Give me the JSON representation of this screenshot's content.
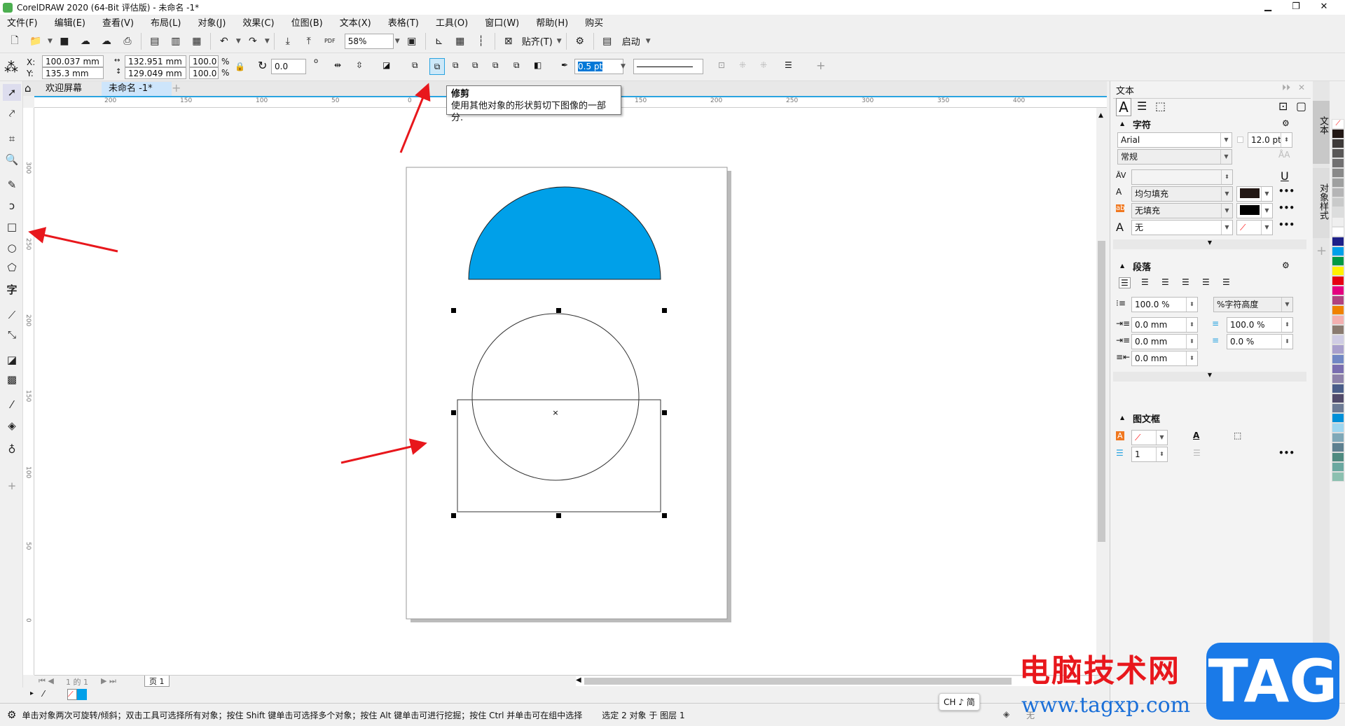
{
  "app": {
    "title": "CorelDRAW 2020 (64-Bit 评估版) - 未命名 -1*"
  },
  "menu": [
    "文件(F)",
    "编辑(E)",
    "查看(V)",
    "布局(L)",
    "对象(J)",
    "效果(C)",
    "位图(B)",
    "文本(X)",
    "表格(T)",
    "工具(O)",
    "窗口(W)",
    "帮助(H)",
    "购买"
  ],
  "toolbar": {
    "zoom": "58%",
    "snap_label": "贴齐(T)",
    "launch_label": "启动",
    "pdf_label": "PDF"
  },
  "props": {
    "x": "100.037 mm",
    "y": "135.3 mm",
    "x_label": "X:",
    "y_label": "Y:",
    "width": "132.951 mm",
    "height": "129.049 mm",
    "scale_x": "100.0",
    "scale_y": "100.0",
    "pct": "%",
    "rotation": "0.0",
    "outline": "0.5 pt",
    "deg": "o"
  },
  "tabs": {
    "welcome": "欢迎屏幕",
    "doc": "未命名 -1*"
  },
  "tooltip": {
    "title": "修剪",
    "body": "使用其他对象的形状剪切下图像的一部分."
  },
  "ruler": {
    "top": [
      "200",
      "150",
      "100",
      "50",
      "0",
      "150",
      "200",
      "250",
      "300",
      "350",
      "400"
    ],
    "left": [
      "300",
      "250",
      "200",
      "150",
      "100",
      "50",
      "0"
    ]
  },
  "docker": {
    "title": "文本",
    "character": {
      "heading": "字符",
      "font": "Arial",
      "size": "12.0 pt",
      "style": "常规",
      "fill": "均匀填充",
      "bg_fill": "无填充",
      "outline": "无"
    },
    "paragraph": {
      "heading": "段落",
      "line_spacing": "100.0 %",
      "spacing_unit": "%字符高度",
      "indent_first": "0.0 mm",
      "indent_left": "0.0 mm",
      "indent_right": "0.0 mm",
      "before": "100.0 %",
      "after": "0.0 %"
    },
    "frame": {
      "heading": "图文框",
      "columns": "1"
    },
    "side_tabs": [
      "文本",
      "对象样式"
    ],
    "more": "•••"
  },
  "palette": [
    "#231815",
    "#3e3a39",
    "#595757",
    "#717071",
    "#898989",
    "#9fa0a0",
    "#b5b5b6",
    "#c9caca",
    "#dcdddd",
    "#efefef",
    "#ffffff",
    "#1d2088",
    "#00a0e9",
    "#009944",
    "#fff100",
    "#e60012",
    "#e4007f",
    "#b0427f",
    "#ef8200",
    "#f3b0b0",
    "#8a7b70",
    "#cfcce4",
    "#a89fcc",
    "#7187c4",
    "#7a6eb0",
    "#8e82aa",
    "#4a5e8a",
    "#524b6b",
    "#6c7b95",
    "#0090d8",
    "#9dd6f0",
    "#7fa8b8",
    "#5e8090",
    "#4f8a80",
    "#6aa8a0",
    "#8cc0b0"
  ],
  "colors": {
    "shape_fill": "#00a0e9",
    "accent": "#29a3e0",
    "arrow": "#e8171c"
  },
  "pagenav": {
    "page_info": "1 的 1",
    "page_tab": "页 1"
  },
  "status": {
    "hint": "单击对象两次可旋转/倾斜；双击工具可选择所有对象；按住 Shift 键单击可选择多个对象；按住 Alt 键单击可进行挖掘；按住 Ctrl 并单击可在组中选择",
    "selection": "选定 2 对象 于 图层 1",
    "ime": "CH ♪ 简",
    "fill_none": "无"
  },
  "watermark": {
    "cn": "电脑技术网",
    "url": "www.tagxp.com",
    "logo": "TAG"
  }
}
